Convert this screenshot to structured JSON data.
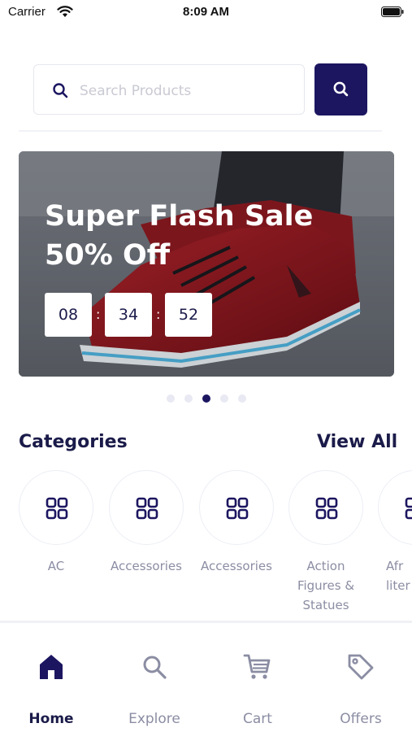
{
  "status_bar": {
    "carrier": "Carrier",
    "time": "8:09 AM"
  },
  "search": {
    "placeholder": "Search Products"
  },
  "banner": {
    "title_line1": "Super Flash Sale",
    "title_line2": "50% Off",
    "countdown": {
      "hours": "08",
      "minutes": "34",
      "seconds": "52",
      "separator": ":"
    }
  },
  "carousel": {
    "slide_count": 5,
    "active_index": 2
  },
  "categories": {
    "heading": "Categories",
    "view_all": "View All",
    "items": [
      {
        "label": "AC",
        "icon": "grid-icon"
      },
      {
        "label": "Accessories",
        "icon": "grid-icon"
      },
      {
        "label": "Accessories",
        "icon": "grid-icon"
      },
      {
        "label": "Action Figures & Statues",
        "icon": "grid-icon"
      },
      {
        "label": "Afr liter",
        "icon": "grid-icon"
      }
    ]
  },
  "bottom_nav": {
    "items": [
      {
        "label": "Home",
        "icon": "home-icon",
        "active": true
      },
      {
        "label": "Explore",
        "icon": "search-icon",
        "active": false
      },
      {
        "label": "Cart",
        "icon": "cart-icon",
        "active": false
      },
      {
        "label": "Offers",
        "icon": "tag-icon",
        "active": false
      }
    ]
  },
  "colors": {
    "primary": "#1c1660",
    "text_dark": "#1b1b4a",
    "text_muted": "#8b8da3"
  }
}
